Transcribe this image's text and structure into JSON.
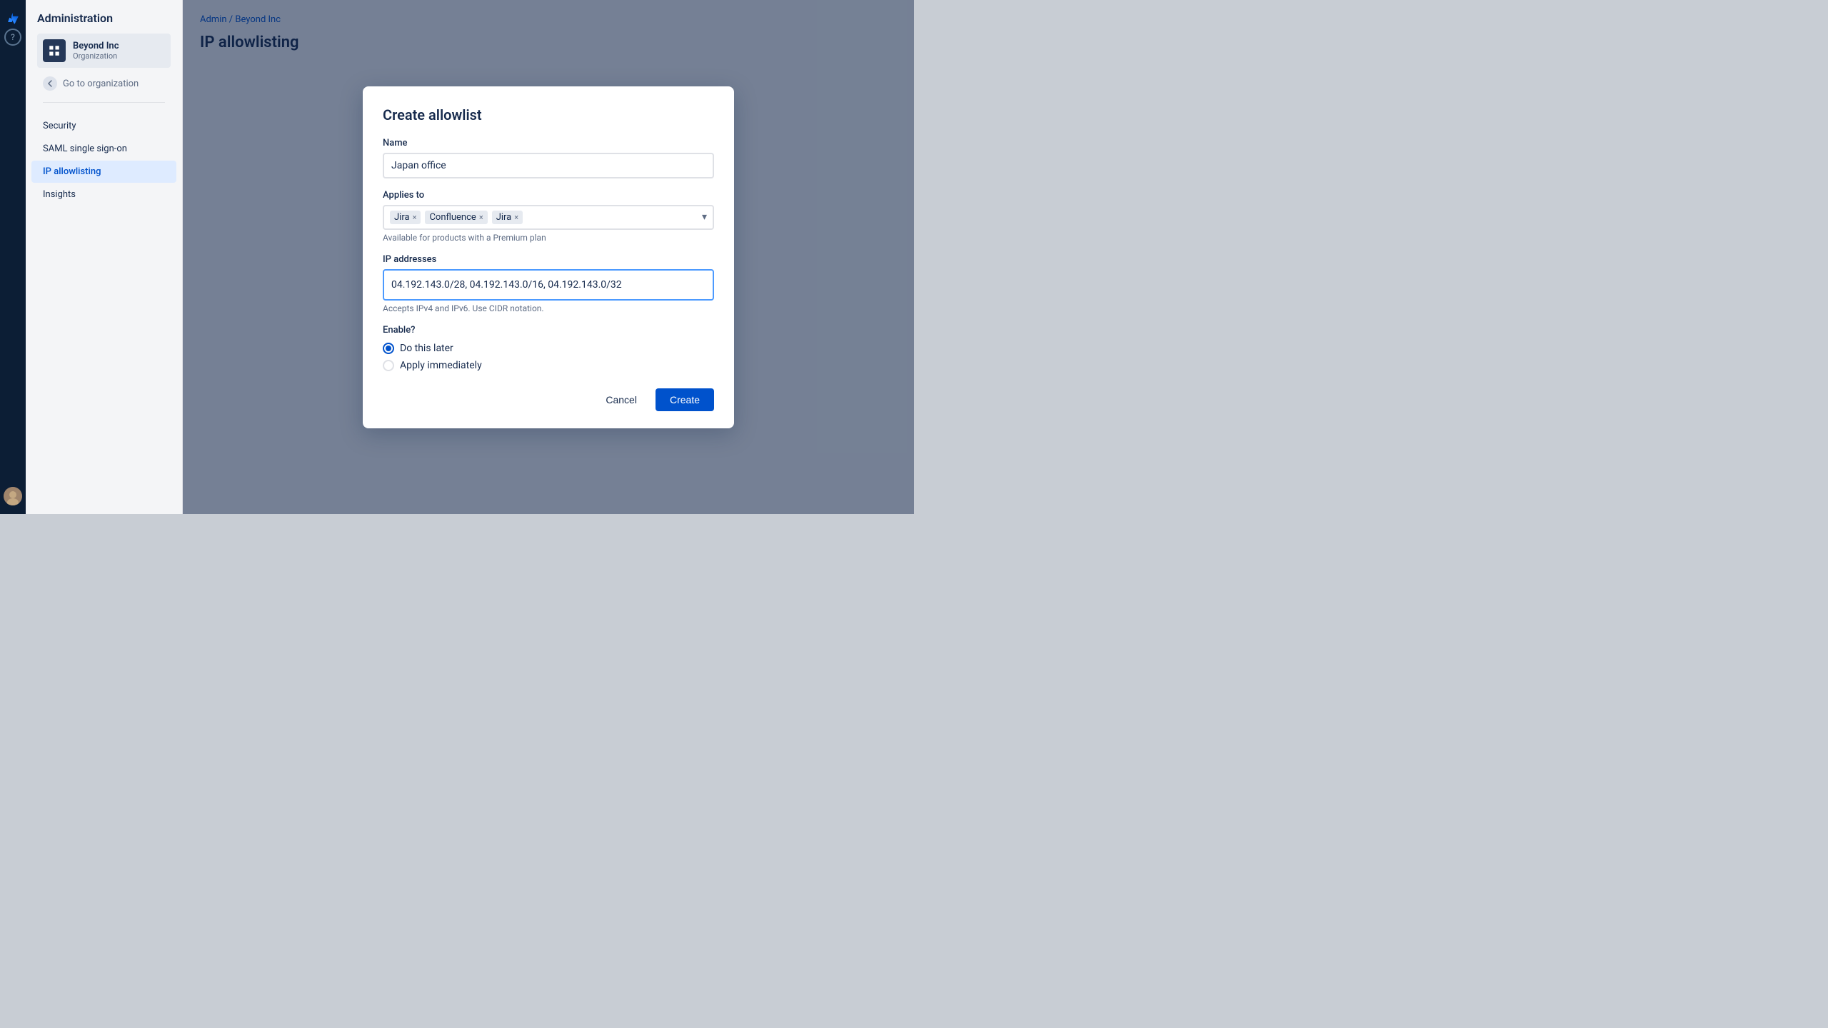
{
  "sidebar": {
    "logo_alt": "Atlassian logo"
  },
  "left_panel": {
    "title": "Administration",
    "org": {
      "name": "Beyond Inc",
      "subtitle": "Organization"
    },
    "go_to_org": "Go to organization",
    "nav_items": [
      {
        "label": "Security",
        "active": false
      },
      {
        "label": "SAML single sign-on",
        "active": false
      },
      {
        "label": "IP allowlisting",
        "active": true
      },
      {
        "label": "Insights",
        "active": false
      }
    ]
  },
  "breadcrumb": {
    "admin": "Admin",
    "separator": "/",
    "org": "Beyond Inc"
  },
  "bg_title": "IP allowlisting",
  "modal": {
    "title": "Create allowlist",
    "name_label": "Name",
    "name_value": "Japan office",
    "applies_to_label": "Applies to",
    "tags": [
      {
        "label": "Jira"
      },
      {
        "label": "Confluence"
      },
      {
        "label": "Jira"
      }
    ],
    "applies_note": "Available for products with a Premium plan",
    "ip_label": "IP addresses",
    "ip_value": "04.192.143.0/28, 04.192.143.0/16, 04.192.143.0/32",
    "ip_note": "Accepts IPv4 and IPv6. Use CIDR notation.",
    "enable_label": "Enable?",
    "radio_options": [
      {
        "label": "Do this later",
        "selected": true
      },
      {
        "label": "Apply immediately",
        "selected": false
      }
    ],
    "cancel_label": "Cancel",
    "create_label": "Create"
  }
}
